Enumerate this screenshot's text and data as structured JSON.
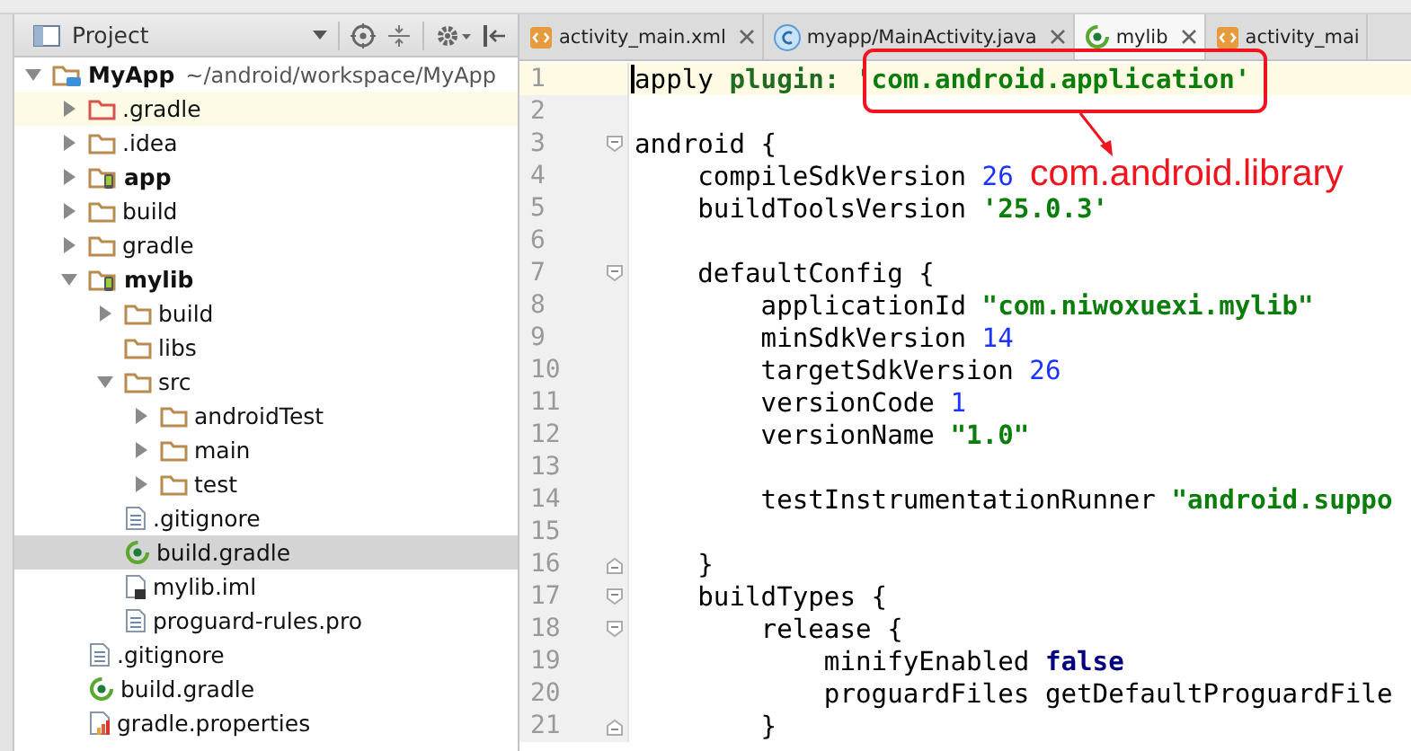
{
  "project_panel": {
    "title": "Project",
    "tree": [
      {
        "label": "MyApp",
        "path": "~/android/workspace/MyApp",
        "kind": "root",
        "expanded": true,
        "selected": false,
        "children": [
          {
            "label": ".gradle",
            "kind": "excluded_folder",
            "expanded": false,
            "selected": false
          },
          {
            "label": ".idea",
            "kind": "folder",
            "expanded": false,
            "selected": false
          },
          {
            "label": "app",
            "kind": "module",
            "expanded": false,
            "selected": false
          },
          {
            "label": "build",
            "kind": "folder",
            "expanded": false,
            "selected": false
          },
          {
            "label": "gradle",
            "kind": "folder",
            "expanded": false,
            "selected": false
          },
          {
            "label": "mylib",
            "kind": "module",
            "expanded": true,
            "selected": false,
            "children": [
              {
                "label": "build",
                "kind": "folder",
                "expanded": false,
                "selected": false
              },
              {
                "label": "libs",
                "kind": "folder",
                "selected": false
              },
              {
                "label": "src",
                "kind": "folder",
                "expanded": true,
                "selected": false,
                "children": [
                  {
                    "label": "androidTest",
                    "kind": "folder",
                    "expanded": false,
                    "selected": false
                  },
                  {
                    "label": "main",
                    "kind": "folder",
                    "expanded": false,
                    "selected": false
                  },
                  {
                    "label": "test",
                    "kind": "folder",
                    "expanded": false,
                    "selected": false
                  }
                ]
              },
              {
                "label": ".gitignore",
                "kind": "text_file",
                "selected": false
              },
              {
                "label": "build.gradle",
                "kind": "gradle_file",
                "selected": true
              },
              {
                "label": "mylib.iml",
                "kind": "iml_file",
                "selected": false
              },
              {
                "label": "proguard-rules.pro",
                "kind": "text_file",
                "selected": false
              }
            ]
          },
          {
            "label": ".gitignore",
            "kind": "text_file",
            "selected": false
          },
          {
            "label": "build.gradle",
            "kind": "gradle_file",
            "selected": false
          },
          {
            "label": "gradle.properties",
            "kind": "properties_file",
            "selected": false
          }
        ]
      }
    ]
  },
  "editor": {
    "tabs": [
      {
        "label": "activity_main.xml",
        "kind": "xml",
        "selected": false,
        "closable": true
      },
      {
        "label": "myapp/MainActivity.java",
        "kind": "class",
        "selected": false,
        "closable": true
      },
      {
        "label": "mylib",
        "kind": "gradle",
        "selected": true,
        "closable": true
      },
      {
        "label": "activity_mai",
        "kind": "xml",
        "selected": false,
        "closable": false
      }
    ],
    "lines": [
      {
        "number": "1",
        "current": true,
        "fold_start": false,
        "fold_end": false,
        "tokens": [
          {
            "text": "apply ",
            "kind": "plain"
          },
          {
            "text": "plugin: ",
            "kind": "label"
          },
          {
            "text": "'com.android.application'",
            "kind": "string"
          }
        ]
      },
      {
        "number": "2",
        "current": false,
        "fold_start": false,
        "fold_end": false
      },
      {
        "number": "3",
        "current": false,
        "fold_start": true,
        "fold_end": false,
        "tokens": [
          {
            "text": "android {",
            "kind": "plain"
          }
        ]
      },
      {
        "number": "4",
        "current": false,
        "fold_start": false,
        "fold_end": false,
        "tokens": [
          {
            "text": "    compileSdkVersion ",
            "kind": "plain"
          },
          {
            "text": "26",
            "kind": "number"
          }
        ]
      },
      {
        "number": "5",
        "current": false,
        "fold_start": false,
        "fold_end": false,
        "tokens": [
          {
            "text": "    buildToolsVersion ",
            "kind": "plain"
          },
          {
            "text": "'25.0.3'",
            "kind": "string"
          }
        ]
      },
      {
        "number": "6",
        "current": false,
        "fold_start": false,
        "fold_end": false
      },
      {
        "number": "7",
        "current": false,
        "fold_start": true,
        "fold_end": false,
        "tokens": [
          {
            "text": "    defaultConfig {",
            "kind": "plain"
          }
        ]
      },
      {
        "number": "8",
        "current": false,
        "fold_start": false,
        "fold_end": false,
        "tokens": [
          {
            "text": "        applicationId ",
            "kind": "plain"
          },
          {
            "text": "\"com.niwoxuexi.mylib\"",
            "kind": "string"
          }
        ]
      },
      {
        "number": "9",
        "current": false,
        "fold_start": false,
        "fold_end": false,
        "tokens": [
          {
            "text": "        minSdkVersion ",
            "kind": "plain"
          },
          {
            "text": "14",
            "kind": "number"
          }
        ]
      },
      {
        "number": "10",
        "current": false,
        "fold_start": false,
        "fold_end": false,
        "tokens": [
          {
            "text": "        targetSdkVersion ",
            "kind": "plain"
          },
          {
            "text": "26",
            "kind": "number"
          }
        ]
      },
      {
        "number": "11",
        "current": false,
        "fold_start": false,
        "fold_end": false,
        "tokens": [
          {
            "text": "        versionCode ",
            "kind": "plain"
          },
          {
            "text": "1",
            "kind": "number"
          }
        ]
      },
      {
        "number": "12",
        "current": false,
        "fold_start": false,
        "fold_end": false,
        "tokens": [
          {
            "text": "        versionName ",
            "kind": "plain"
          },
          {
            "text": "\"1.0\"",
            "kind": "string"
          }
        ]
      },
      {
        "number": "13",
        "current": false,
        "fold_start": false,
        "fold_end": false
      },
      {
        "number": "14",
        "current": false,
        "fold_start": false,
        "fold_end": false,
        "tokens": [
          {
            "text": "        testInstrumentationRunner ",
            "kind": "plain"
          },
          {
            "text": "\"android.suppo",
            "kind": "string"
          }
        ]
      },
      {
        "number": "15",
        "current": false,
        "fold_start": false,
        "fold_end": false
      },
      {
        "number": "16",
        "current": false,
        "fold_start": false,
        "fold_end": true,
        "tokens": [
          {
            "text": "    }",
            "kind": "plain"
          }
        ]
      },
      {
        "number": "17",
        "current": false,
        "fold_start": true,
        "fold_end": false,
        "tokens": [
          {
            "text": "    buildTypes {",
            "kind": "plain"
          }
        ]
      },
      {
        "number": "18",
        "current": false,
        "fold_start": true,
        "fold_end": false,
        "tokens": [
          {
            "text": "        release {",
            "kind": "plain"
          }
        ]
      },
      {
        "number": "19",
        "current": false,
        "fold_start": false,
        "fold_end": false,
        "tokens": [
          {
            "text": "            minifyEnabled ",
            "kind": "plain"
          },
          {
            "text": "false",
            "kind": "keyword"
          }
        ]
      },
      {
        "number": "20",
        "current": false,
        "fold_start": false,
        "fold_end": false,
        "tokens": [
          {
            "text": "            proguardFiles getDefaultProguardFile",
            "kind": "plain"
          }
        ]
      },
      {
        "number": "21",
        "current": false,
        "fold_start": false,
        "fold_end": true,
        "tokens": [
          {
            "text": "        }",
            "kind": "plain"
          }
        ]
      }
    ],
    "annotation": {
      "text": "com.android.library"
    }
  }
}
